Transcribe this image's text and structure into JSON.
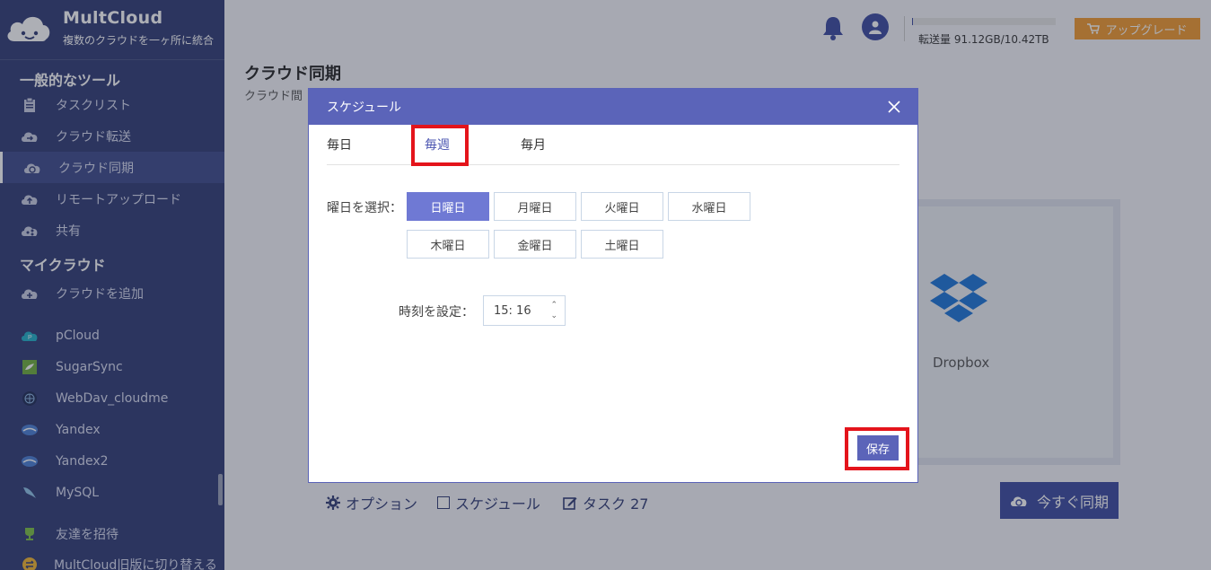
{
  "brand": {
    "name": "MultCloud",
    "tagline": "複数のクラウドを一ヶ所に統合"
  },
  "sidebar": {
    "section_tools": "一般的なツール",
    "tools": [
      {
        "label": "タスクリスト",
        "icon": "clipboard-icon"
      },
      {
        "label": "クラウド転送",
        "icon": "cloud-transfer-icon"
      },
      {
        "label": "クラウド同期",
        "icon": "cloud-sync-icon",
        "active": true
      },
      {
        "label": "リモートアップロード",
        "icon": "cloud-upload-icon"
      },
      {
        "label": "共有",
        "icon": "share-icon"
      }
    ],
    "section_clouds": "マイクラウド",
    "add_cloud": "クラウドを追加",
    "clouds": [
      {
        "label": "pCloud",
        "icon": "pcloud-icon"
      },
      {
        "label": "SugarSync",
        "icon": "sugarsync-icon"
      },
      {
        "label": "WebDav_cloudme",
        "icon": "webdav-icon"
      },
      {
        "label": "Yandex",
        "icon": "yandex-icon"
      },
      {
        "label": "Yandex2",
        "icon": "yandex-icon"
      },
      {
        "label": "MySQL",
        "icon": "mysql-icon"
      }
    ],
    "invite": "友達を招待",
    "switch_old": "MultCloud旧版に切り替える"
  },
  "header": {
    "quota_text": "転送量 91.12GB/10.42TB",
    "quota_used_fraction": 0.009,
    "upgrade_label": "アップグレード"
  },
  "page": {
    "title": "クラウド同期",
    "subtitle": "クラウド間"
  },
  "destination": {
    "label": "Dropbox"
  },
  "bottom": {
    "options": "オプション",
    "schedule": "スケジュール",
    "task": "タスク 27",
    "sync_now": "今すぐ同期"
  },
  "modal": {
    "title": "スケジュール",
    "tabs": [
      "毎日",
      "毎週",
      "毎月"
    ],
    "selected_tab": "毎週",
    "weekday_label": "曜日を選択：",
    "weekdays": [
      "日曜日",
      "月曜日",
      "火曜日",
      "水曜日",
      "木曜日",
      "金曜日",
      "土曜日"
    ],
    "selected_day": "日曜日",
    "time_label": "時刻を設定：",
    "time_value": "15: 16",
    "save_label": "保存"
  },
  "colors": {
    "sidebar_bg": "#2f3a75",
    "accent": "#5b64b9",
    "upgrade": "#f29a2e",
    "highlight": "#e4141b"
  }
}
